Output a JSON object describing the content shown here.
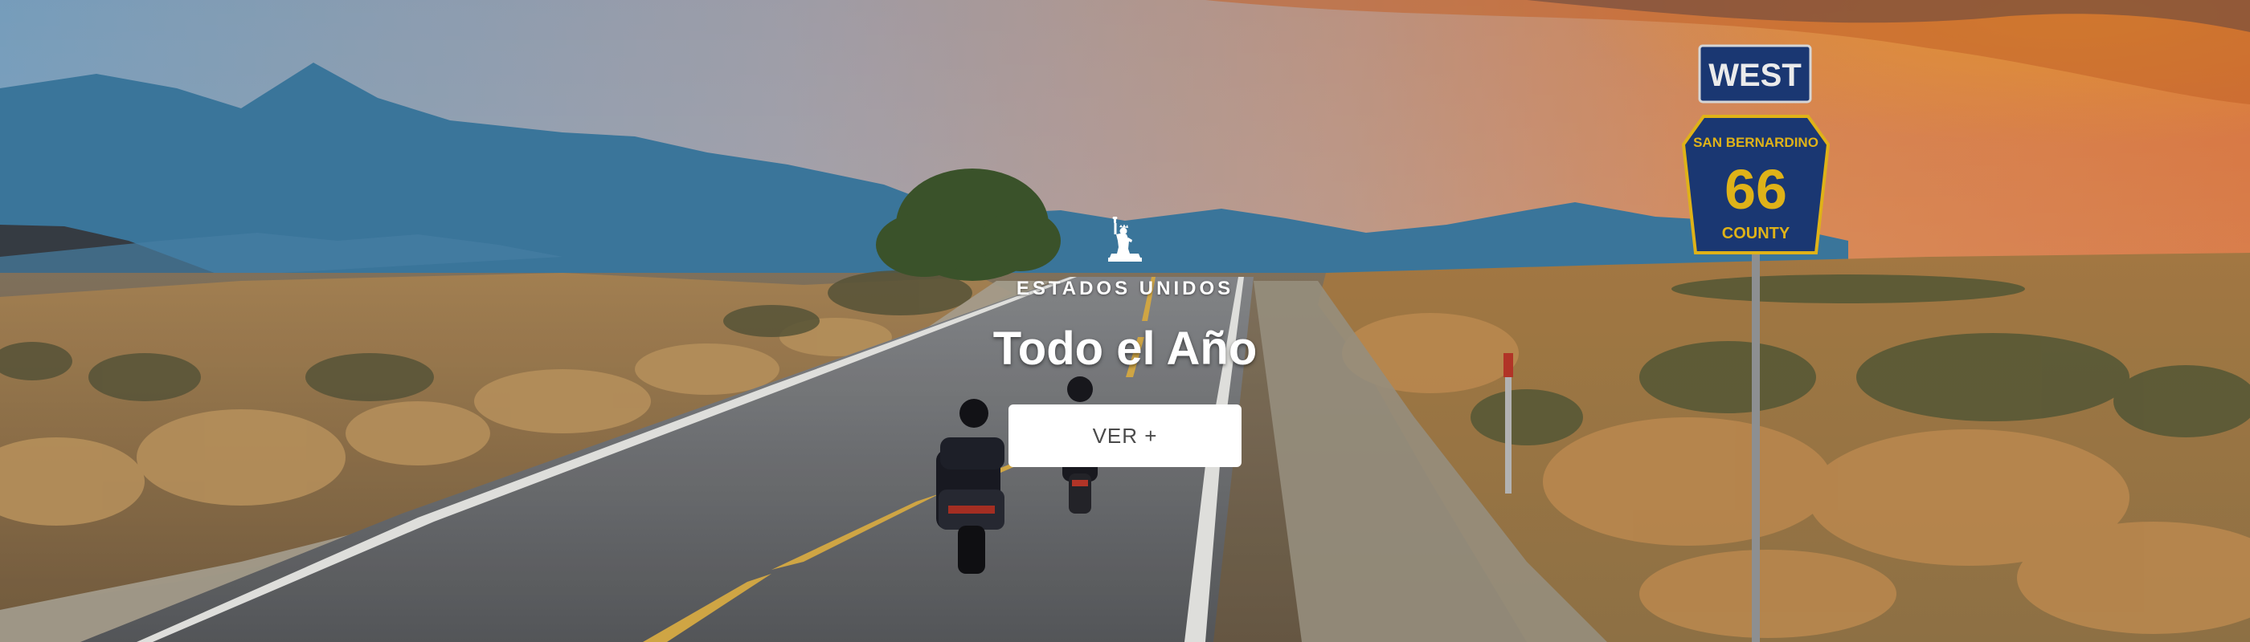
{
  "hero": {
    "icon": "statue-of-liberty-icon",
    "eyebrow": "ESTADOS UNIDOS",
    "title": "Todo el Año",
    "cta_label": "VER +"
  },
  "sign": {
    "direction": "WEST",
    "county_top": "SAN BERNARDINO",
    "route_number": "66",
    "county_bottom": "COUNTY"
  },
  "colors": {
    "sign_blue": "#1d3c7c",
    "sign_yellow": "#f2c21b",
    "button_bg": "#ffffff",
    "button_text": "#4a4a4a"
  }
}
